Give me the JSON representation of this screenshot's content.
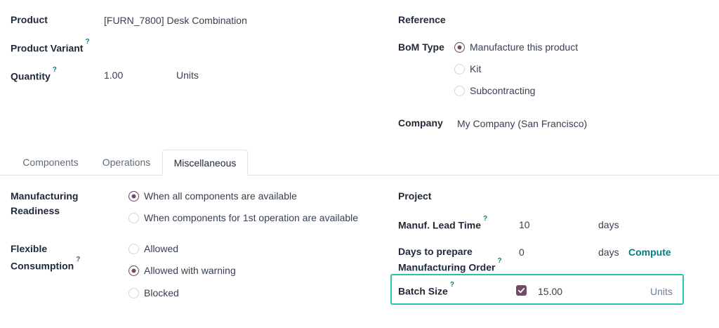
{
  "top": {
    "product_label": "Product",
    "product_value": "[FURN_7800] Desk Combination",
    "variant_label": "Product Variant",
    "quantity_label": "Quantity",
    "quantity_value": "1.00",
    "quantity_uom": "Units",
    "reference_label": "Reference",
    "bom_type_label": "BoM Type",
    "bom_type_options": [
      "Manufacture this product",
      "Kit",
      "Subcontracting"
    ],
    "bom_type_selected": "Manufacture this product",
    "company_label": "Company",
    "company_value": "My Company (San Francisco)",
    "help_mark": "?"
  },
  "tabs": [
    {
      "label": "Components",
      "active": false
    },
    {
      "label": "Operations",
      "active": false
    },
    {
      "label": "Miscellaneous",
      "active": true
    }
  ],
  "misc": {
    "readiness_label_1": "Manufacturing",
    "readiness_label_2": "Readiness",
    "readiness_options": [
      "When all components are available",
      "When components for 1st operation are available"
    ],
    "readiness_selected": "When all components are available",
    "flexible_label_1": "Flexible",
    "flexible_label_2": "Consumption",
    "flexible_options": [
      "Allowed",
      "Allowed with warning",
      "Blocked"
    ],
    "flexible_selected": "Allowed with warning",
    "project_label": "Project",
    "lead_time_label": "Manuf. Lead Time",
    "lead_time_value": "10",
    "lead_time_unit": "days",
    "days_prepare_label_1": "Days to prepare",
    "days_prepare_label_2": "Manufacturing Order",
    "days_prepare_value": "0",
    "days_prepare_unit": "days",
    "compute_label": "Compute",
    "batch_size_label": "Batch Size",
    "batch_size_checked": true,
    "batch_size_value": "15.00",
    "batch_size_uom": "Units"
  },
  "colors": {
    "accent": "#714b67",
    "help": "#017e84",
    "highlight": "#2cc4a8"
  }
}
